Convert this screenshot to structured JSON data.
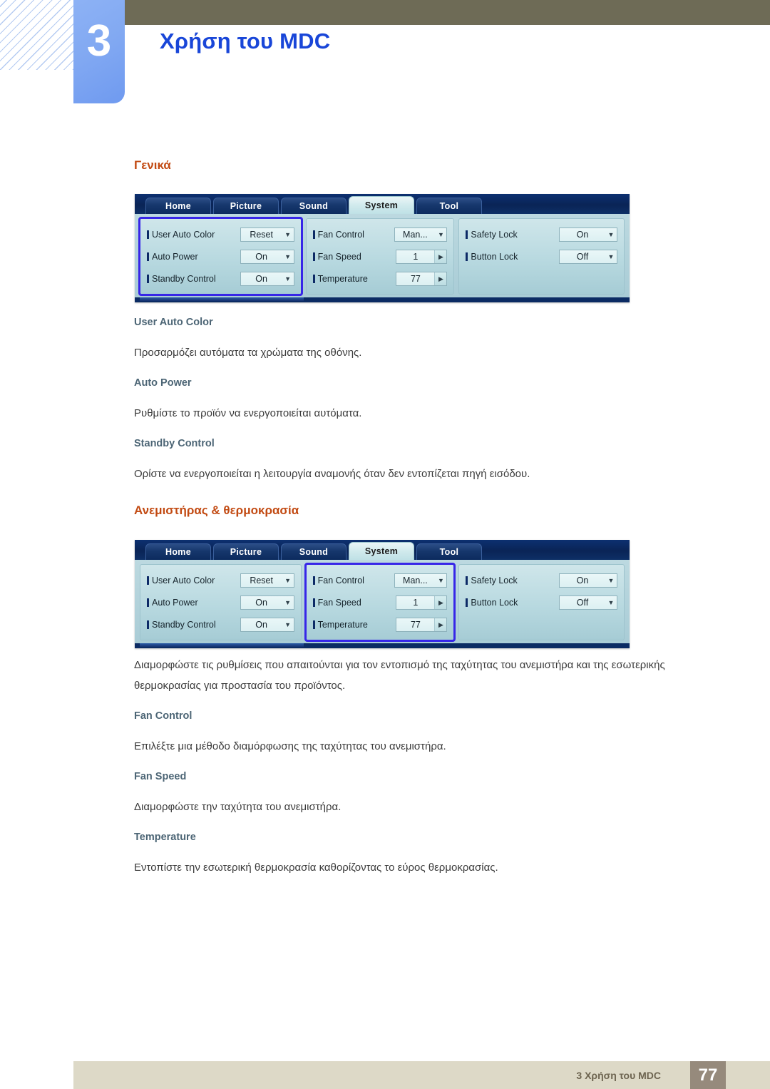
{
  "header": {
    "chapter_number": "3",
    "chapter_title": "Χρήση του MDC"
  },
  "sections": [
    {
      "title": "Γενικά",
      "headings": [
        {
          "label": "User Auto Color",
          "text": "Προσαρμόζει αυτόματα τα χρώματα της οθόνης."
        },
        {
          "label": "Auto Power",
          "text": "Ρυθμίστε το προϊόν να ενεργοποιείται αυτόματα."
        },
        {
          "label": "Standby Control",
          "text": "Ορίστε να ενεργοποιείται η λειτουργία αναμονής όταν δεν εντοπίζεται πηγή εισόδου."
        }
      ]
    },
    {
      "title": "Ανεμιστήρας & θερμοκρασία",
      "intro": "Διαμορφώστε τις ρυθμίσεις που απαιτούνται για τον εντοπισμό της ταχύτητας του ανεμιστήρα και της εσωτερικής θερμοκρασίας για προστασία του προϊόντος.",
      "headings": [
        {
          "label": "Fan Control",
          "text": "Επιλέξτε μια μέθοδο διαμόρφωσης της ταχύτητας του ανεμιστήρα."
        },
        {
          "label": "Fan Speed",
          "text": "Διαμορφώστε την ταχύτητα του ανεμιστήρα."
        },
        {
          "label": "Temperature",
          "text": "Εντοπίστε την εσωτερική θερμοκρασία καθορίζοντας το εύρος θερμοκρασίας."
        }
      ]
    }
  ],
  "mdc": {
    "tabs": [
      {
        "label": "Home",
        "active": false
      },
      {
        "label": "Picture",
        "active": false
      },
      {
        "label": "Sound",
        "active": false
      },
      {
        "label": "System",
        "active": true
      },
      {
        "label": "Tool",
        "active": false
      }
    ],
    "panel_left": {
      "rows": [
        {
          "label": "User Auto Color",
          "value": "Reset",
          "control": "dropdown",
          "icon": "chevron-down-icon"
        },
        {
          "label": "Auto Power",
          "value": "On",
          "control": "dropdown",
          "icon": "chevron-down-icon"
        },
        {
          "label": "Standby Control",
          "value": "On",
          "control": "dropdown",
          "icon": "chevron-down-icon"
        }
      ]
    },
    "panel_middle": {
      "rows": [
        {
          "label": "Fan Control",
          "value": "Man...",
          "control": "dropdown",
          "icon": "chevron-down-icon"
        },
        {
          "label": "Fan Speed",
          "value": "1",
          "control": "spinner",
          "icon": "chevron-right-icon"
        },
        {
          "label": "Temperature",
          "value": "77",
          "control": "spinner",
          "icon": "chevron-right-icon"
        }
      ]
    },
    "panel_right": {
      "rows": [
        {
          "label": "Safety Lock",
          "value": "On",
          "control": "dropdown",
          "icon": "chevron-down-icon"
        },
        {
          "label": "Button Lock",
          "value": "Off",
          "control": "dropdown",
          "icon": "chevron-down-icon"
        }
      ]
    },
    "highlight_first": "panel_left",
    "highlight_second": "panel_middle"
  },
  "footer": {
    "text": "3 Χρήση του MDC",
    "page": "77"
  },
  "colors": {
    "accent_orange": "#c24a12",
    "heading_slate": "#4c6575",
    "chapter_blue": "#1946d8",
    "topbar_olive": "#6e6b56",
    "footer_tan": "#ddd9c7",
    "footer_page_box": "#968a7c",
    "highlight_blue": "#3726e8"
  }
}
